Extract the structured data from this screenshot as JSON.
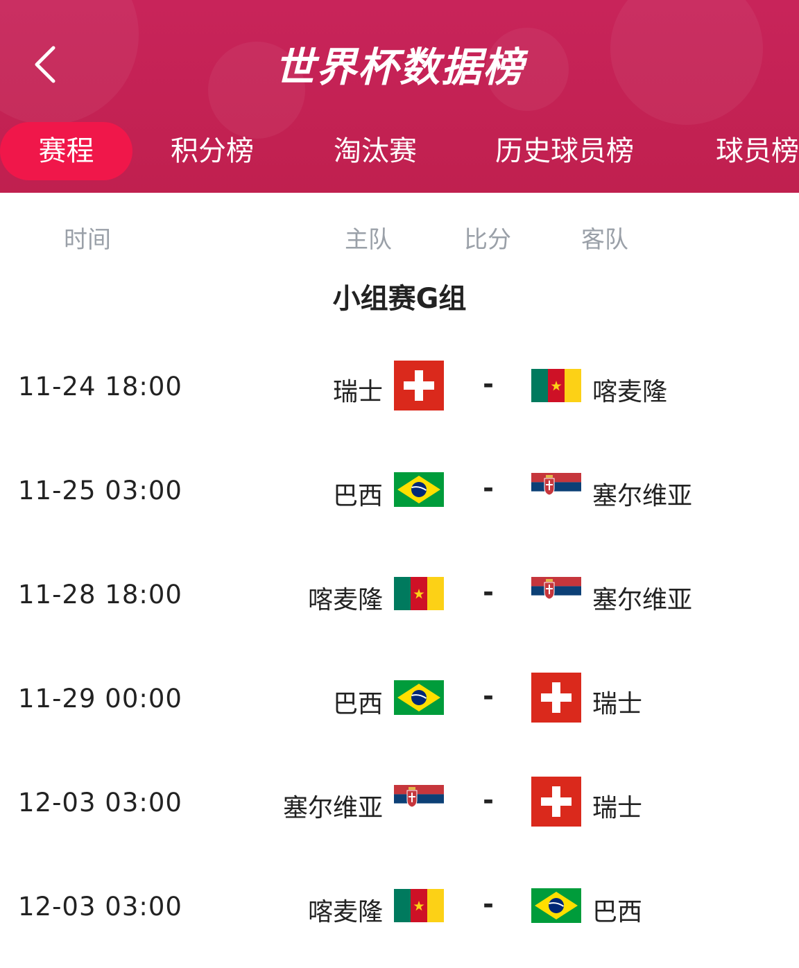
{
  "header": {
    "title": "世界杯数据榜",
    "back_icon": "chevron-left-icon",
    "background": "#c8245a"
  },
  "tabs": [
    {
      "label": "赛程",
      "active": true
    },
    {
      "label": "积分榜",
      "active": false
    },
    {
      "label": "淘汰赛",
      "active": false
    },
    {
      "label": "历史球员榜",
      "active": false
    },
    {
      "label": "球员榜",
      "active": false
    }
  ],
  "columns": {
    "time": "时间",
    "home": "主队",
    "score": "比分",
    "away": "客队"
  },
  "group": {
    "title": "小组赛G组"
  },
  "matches": [
    {
      "time": "11-24 18:00",
      "home": "瑞士",
      "home_flag": "switzerland",
      "score": "-",
      "away": "喀麦隆",
      "away_flag": "cameroon"
    },
    {
      "time": "11-25 03:00",
      "home": "巴西",
      "home_flag": "brazil",
      "score": "-",
      "away": "塞尔维亚",
      "away_flag": "serbia"
    },
    {
      "time": "11-28 18:00",
      "home": "喀麦隆",
      "home_flag": "cameroon",
      "score": "-",
      "away": "塞尔维亚",
      "away_flag": "serbia"
    },
    {
      "time": "11-29 00:00",
      "home": "巴西",
      "home_flag": "brazil",
      "score": "-",
      "away": "瑞士",
      "away_flag": "switzerland"
    },
    {
      "time": "12-03 03:00",
      "home": "塞尔维亚",
      "home_flag": "serbia",
      "score": "-",
      "away": "瑞士",
      "away_flag": "switzerland"
    },
    {
      "time": "12-03 03:00",
      "home": "喀麦隆",
      "home_flag": "cameroon",
      "score": "-",
      "away": "巴西",
      "away_flag": "brazil"
    }
  ],
  "colors": {
    "accent": "#f0174a",
    "header_text": "#ffffff",
    "muted_text": "#9aa0a8"
  }
}
